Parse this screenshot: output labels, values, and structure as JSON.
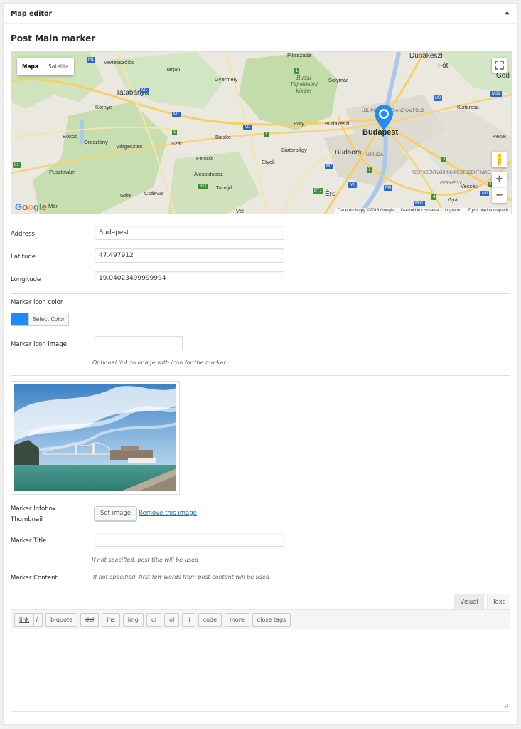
{
  "panel": {
    "title": "Map editor"
  },
  "section": {
    "title": "Post Main marker"
  },
  "map": {
    "type_buttons": [
      "Mapa",
      "Satelita"
    ],
    "marker_color": "#1e8cfa",
    "labels": {
      "pilisszaba": "Pilisszaba",
      "dunakeszi": "Dunakeszi",
      "fot": "Fót",
      "godollo": "Göd",
      "vertesszolos": "Vértesszőlős",
      "tarjan": "Tarján",
      "gyermely": "Gyermely",
      "budai": "Budai\nTájvédelmi\nkörzet",
      "solymar": "Solymár",
      "tatabanya": "Tatabánya",
      "kornye": "Környe",
      "ujlipotvaros": "ÚJLIPÓTVÁROS-ANGYALFÖLD",
      "kistarcsa": "Kistarcsa",
      "paty": "Páty",
      "budakeszi": "Budakeszi",
      "budapest": "Budapest",
      "bokod": "Bokod",
      "oroszlany": "Oroszlány",
      "vargesztes": "Várgesztes",
      "szar": "Szár",
      "bicske": "Bicske",
      "biatorbagy": "Biatorbágy",
      "budaors": "Budaörs",
      "ujbuda": "ÚJBUDA",
      "pecel": "Pécel",
      "felcsut": "Felcsút",
      "etyek": "Etyek",
      "pusztavam": "Pusztavám",
      "alcsutdoboz": "Alcsútdoboz",
      "pestszentlorinc": "PESTSZENTLŐRINC-PESTSZENTIMRE",
      "ferihegy": "FERIHEGY",
      "tabajd": "Tabajd",
      "erd": "Érd",
      "vecses": "Vecsés",
      "gant": "Gánt",
      "csakvar": "Csákvár",
      "gyal": "Gyál",
      "mor": "Mór",
      "val": "Vál"
    },
    "shields": [
      "M1",
      "M1",
      "M1",
      "M1",
      "M0",
      "M31",
      "1",
      "1",
      "1",
      "81",
      "M7",
      "7",
      "M0",
      "M0",
      "811",
      "E71",
      "4",
      "M51",
      "4",
      "4",
      "M0"
    ],
    "google_logo": "Google",
    "attribution": [
      "Dane do Mapy ©2018 Google",
      "Warunki korzystania z programu",
      "Zgłoś błąd w mapach"
    ],
    "zoom_in": "+",
    "zoom_out": "−"
  },
  "form": {
    "address": {
      "label": "Address",
      "value": "Budapest"
    },
    "latitude": {
      "label": "Latitude",
      "value": "47.497912"
    },
    "longitude": {
      "label": "Longitude",
      "value": "19.04023499999994"
    },
    "marker_icon_color": {
      "label": "Marker icon color",
      "button": "Select Color",
      "color": "#1e8cfa"
    },
    "marker_icon_image": {
      "label": "Marker icon image",
      "value": "",
      "help": "Optional link to image with icon for the marker"
    },
    "thumbnail": {
      "label_line1": "Marker Infobox",
      "label_line2": "Thumbnail",
      "set_button": "Set image",
      "remove_link": "Remove this image"
    },
    "marker_title": {
      "label": "Marker Title",
      "value": "",
      "help": "If not specified, post title will be used"
    },
    "marker_content": {
      "label": "Marker Content",
      "help": "If not specified, first few words from post content will be used"
    }
  },
  "editor": {
    "tabs": [
      "Visual",
      "Text"
    ],
    "active_tab": "Text",
    "quicktags": [
      "b",
      "i",
      "link",
      "b-quote",
      "del",
      "ins",
      "img",
      "ul",
      "ol",
      "li",
      "code",
      "more",
      "close tags"
    ],
    "content": ""
  }
}
